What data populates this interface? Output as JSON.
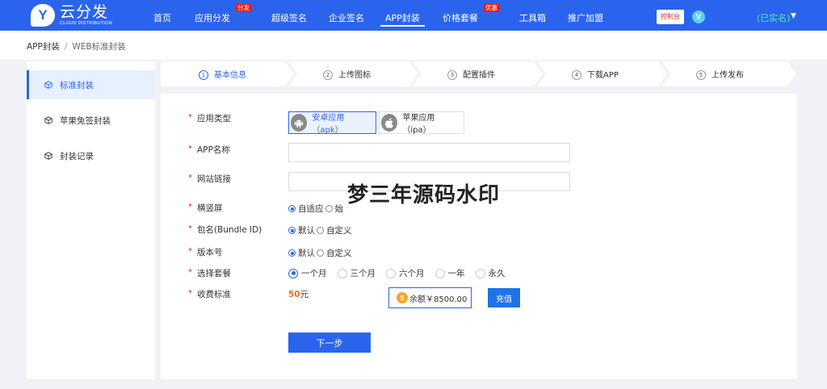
{
  "brand": {
    "logo_letter": "Y",
    "name": "云分发",
    "sub": "CLOUD DISTRIBUTION"
  },
  "nav": [
    {
      "label": "首页"
    },
    {
      "label": "应用分发",
      "badge": "分发"
    },
    {
      "label": "超级签名"
    },
    {
      "label": "企业签名"
    },
    {
      "label": "APP封装",
      "active": true
    },
    {
      "label": "价格套餐",
      "badge": "优惠"
    },
    {
      "label": "工具箱"
    },
    {
      "label": "推广加盟"
    }
  ],
  "header_right": {
    "console": "控制台",
    "vip": "V",
    "user_status": "(已实名)"
  },
  "breadcrumb": {
    "root": "APP封装",
    "separator": "/",
    "current": "WEB标准封装"
  },
  "sidebar": [
    {
      "label": "标准封装",
      "icon": "cube-icon",
      "active": true
    },
    {
      "label": "苹果免签封装",
      "icon": "cube-icon"
    },
    {
      "label": "封装记录",
      "icon": "cube-icon"
    }
  ],
  "steps": [
    {
      "num": "1",
      "label": "基本信息",
      "active": true
    },
    {
      "num": "2",
      "label": "上传图标"
    },
    {
      "num": "3",
      "label": "配置插件"
    },
    {
      "num": "4",
      "label": "下载APP"
    },
    {
      "num": "5",
      "label": "上传发布"
    }
  ],
  "form": {
    "app_type": {
      "label": "应用类型",
      "android": "安卓应用（apk）",
      "ios": "苹果应用（ipa）"
    },
    "app_name": {
      "label": "APP名称",
      "value": ""
    },
    "site_url": {
      "label": "网站链接",
      "value": ""
    },
    "orientation": {
      "label": "横竖屏",
      "options": [
        "自适应",
        "始"
      ]
    },
    "bundle_id": {
      "label": "包名(Bundle ID)",
      "options": [
        "默认",
        "自定义"
      ]
    },
    "version": {
      "label": "版本号",
      "options": [
        "默认",
        "自定义"
      ]
    },
    "plan": {
      "label": "选择套餐",
      "options": [
        "一个月",
        "三个月",
        "六个月",
        "一年",
        "永久"
      ]
    },
    "fee": {
      "label": "收费标准",
      "amount": "50",
      "unit": "元"
    },
    "balance": {
      "coin": "$",
      "text": "余额￥8500.00"
    },
    "recharge": "充值",
    "required_mark": "*"
  },
  "next_button": "下一步",
  "watermark": "梦三年源码水印",
  "colors": {
    "primary": "#2b64ec",
    "badge_red": "#e8211c",
    "verified_green": "#42f3b2",
    "price_orange": "#f0701a"
  }
}
